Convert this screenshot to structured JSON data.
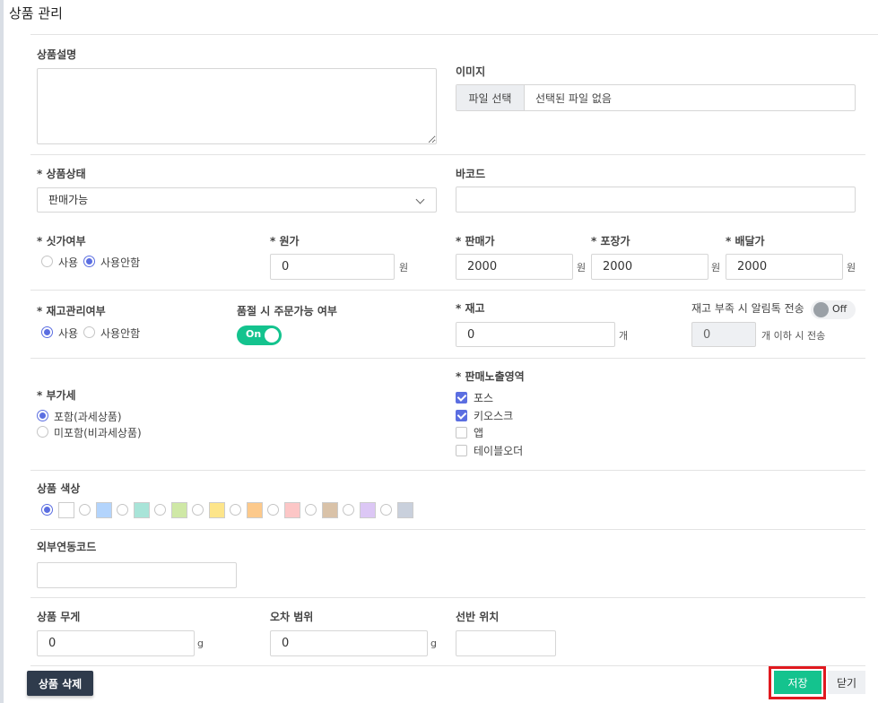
{
  "header": {
    "title": "상품 관리"
  },
  "description": {
    "label": "상품설명",
    "value": ""
  },
  "image": {
    "label": "이미지",
    "button": "파일 선택",
    "filename": "선택된 파일 없음"
  },
  "status": {
    "label": "* 상품상태",
    "value": "판매가능"
  },
  "barcode": {
    "label": "바코드",
    "value": ""
  },
  "ssikga": {
    "label": "* 싯가여부",
    "opt_use": "사용",
    "opt_nouse": "사용안함",
    "selected": "사용안함"
  },
  "cost": {
    "label": "* 원가",
    "value": "0",
    "unit": "원"
  },
  "price": {
    "label": "* 판매가",
    "value": "2000",
    "unit": "원"
  },
  "pack_price": {
    "label": "* 포장가",
    "value": "2000",
    "unit": "원"
  },
  "delivery_price": {
    "label": "* 배달가",
    "value": "2000",
    "unit": "원"
  },
  "stock_mgmt": {
    "label": "* 재고관리여부",
    "opt_use": "사용",
    "opt_nouse": "사용안함",
    "selected": "사용"
  },
  "soldout_order": {
    "label": "품절 시 주문가능 여부",
    "toggle": "On"
  },
  "stock": {
    "label": "* 재고",
    "value": "0",
    "unit": "개"
  },
  "stock_alert": {
    "label": "재고 부족 시 알림톡 전송",
    "toggle": "Off",
    "value": "0",
    "suffix": "개 이하 시 전송"
  },
  "vat": {
    "label": "* 부가세",
    "opt_taxed": "포함(과세상품)",
    "opt_untaxed": "미포함(비과세상품)",
    "selected": "포함(과세상품)"
  },
  "exposure": {
    "label": "* 판매노출영역",
    "items": [
      {
        "label": "포스",
        "checked": true
      },
      {
        "label": "키오스크",
        "checked": true
      },
      {
        "label": "앱",
        "checked": false
      },
      {
        "label": "테이블오더",
        "checked": false
      }
    ]
  },
  "color": {
    "label": "상품 색상",
    "selected_index": 0,
    "swatches": [
      "#ffffff",
      "#b3d4fc",
      "#a8e4d8",
      "#cfe8a6",
      "#fde58a",
      "#fcc98b",
      "#fcc6c6",
      "#d9c2a8",
      "#dcc7f5",
      "#c9d0dc"
    ]
  },
  "external_code": {
    "label": "외부연동코드",
    "value": ""
  },
  "weight": {
    "label": "상품 무게",
    "value": "0",
    "unit": "g"
  },
  "tolerance": {
    "label": "오차 범위",
    "value": "0",
    "unit": "g"
  },
  "shelf": {
    "label": "선반 위치",
    "value": ""
  },
  "footer": {
    "delete": "상품 삭제",
    "save": "저장",
    "close": "닫기"
  }
}
